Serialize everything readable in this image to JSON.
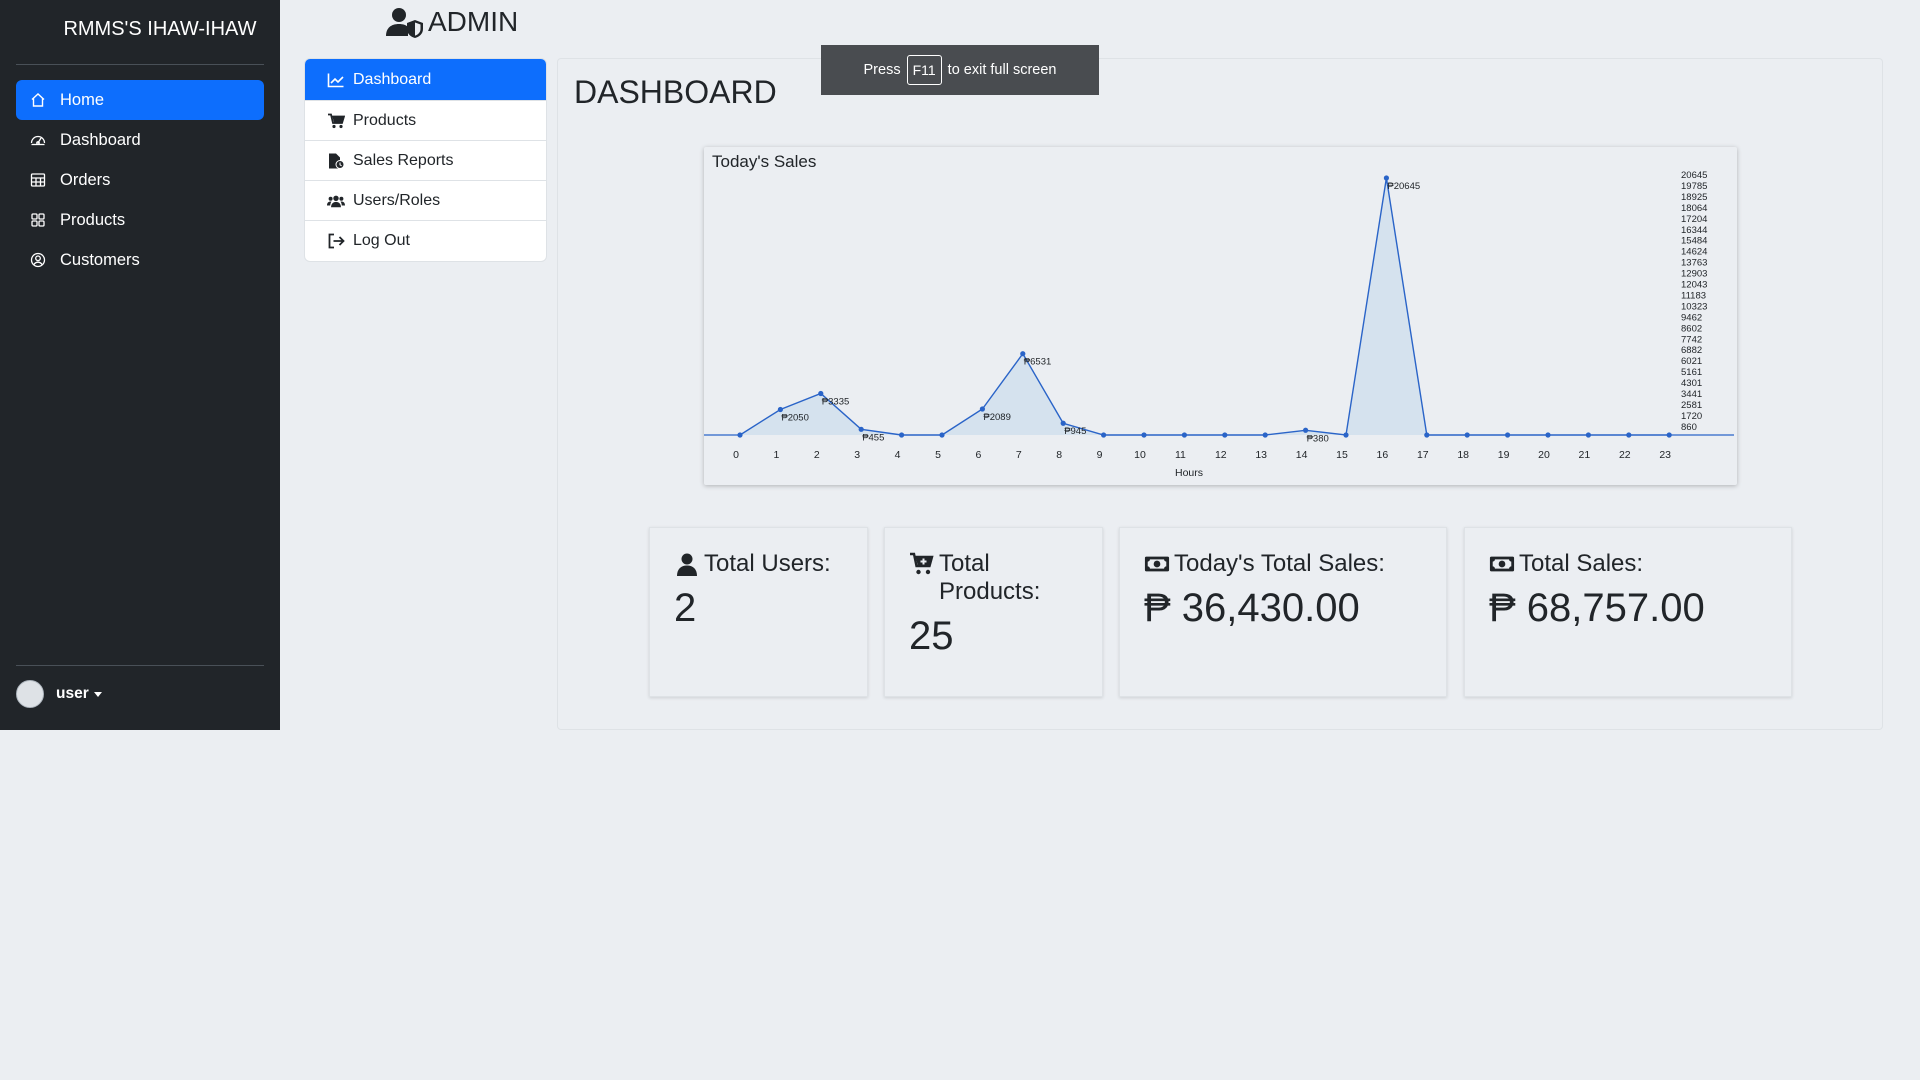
{
  "sidebar": {
    "brand": "RMMS'S IHAW-IHAW",
    "items": [
      {
        "label": "Home",
        "icon": "house-icon",
        "active": true
      },
      {
        "label": "Dashboard",
        "icon": "speedometer-icon",
        "active": false
      },
      {
        "label": "Orders",
        "icon": "table-icon",
        "active": false
      },
      {
        "label": "Products",
        "icon": "grid-icon",
        "active": false
      },
      {
        "label": "Customers",
        "icon": "person-circle-icon",
        "active": false
      }
    ],
    "user": "user"
  },
  "header": {
    "title": "ADMIN"
  },
  "menu": {
    "items": [
      {
        "label": "Dashboard",
        "icon": "chart-line-icon",
        "active": true
      },
      {
        "label": "Products",
        "icon": "cart-icon",
        "active": false
      },
      {
        "label": "Sales Reports",
        "icon": "file-report-icon",
        "active": false
      },
      {
        "label": "Users/Roles",
        "icon": "users-icon",
        "active": false
      },
      {
        "label": "Log Out",
        "icon": "sign-out-icon",
        "active": false
      }
    ]
  },
  "main": {
    "title": "DASHBOARD"
  },
  "toast": {
    "press": "Press",
    "key": "F11",
    "rest": "to exit full screen"
  },
  "chart_data": {
    "type": "area",
    "title": "Today's Sales",
    "xlabel": "Hours",
    "ylabel": "",
    "x": [
      0,
      1,
      2,
      3,
      4,
      5,
      6,
      7,
      8,
      9,
      10,
      11,
      12,
      13,
      14,
      15,
      16,
      17,
      18,
      19,
      20,
      21,
      22,
      23
    ],
    "values": [
      0,
      2050,
      3335,
      455,
      0,
      0,
      2089,
      6531,
      945,
      0,
      0,
      0,
      0,
      0,
      380,
      0,
      20645,
      0,
      0,
      0,
      0,
      0,
      0,
      0
    ],
    "point_labels": {
      "1": "₱2050",
      "2": "₱3335",
      "3": "₱455",
      "6": "₱2089",
      "7": "₱6531",
      "8": "₱945",
      "14": "₱380",
      "16": "₱20645"
    },
    "y_ticks": [
      20645,
      19785,
      18925,
      18064,
      17204,
      16344,
      15484,
      14624,
      13763,
      12903,
      12043,
      11183,
      10323,
      9462,
      8602,
      7742,
      6882,
      6021,
      5161,
      4301,
      3441,
      2581,
      1720,
      860
    ],
    "ylim": [
      0,
      20645
    ],
    "color": "#2a64c8",
    "fill": "#d5e2ee"
  },
  "stats": [
    {
      "label": "Total Users:",
      "value": "2",
      "icon": "user-icon"
    },
    {
      "label": "Total Products:",
      "value": "25",
      "icon": "cart-plus-icon"
    },
    {
      "label": "Today's Total Sales:",
      "value": "₱ 36,430.00",
      "icon": "money-bill-icon"
    },
    {
      "label": "Total Sales:",
      "value": "₱ 68,757.00",
      "icon": "money-bill-icon"
    }
  ]
}
